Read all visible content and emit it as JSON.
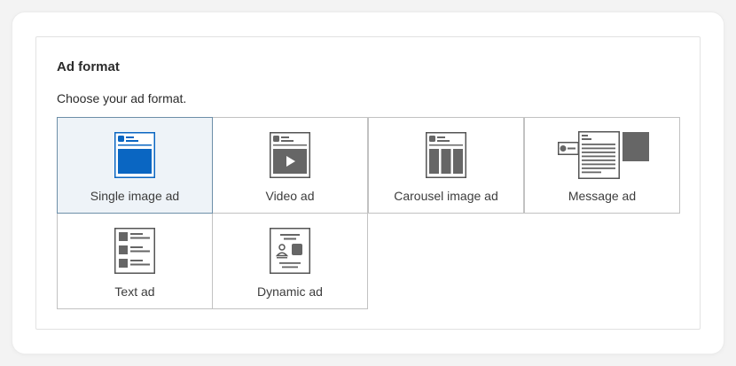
{
  "section": {
    "title": "Ad format",
    "subtitle": "Choose your ad format."
  },
  "formats": [
    {
      "label": "Single image ad",
      "icon": "single-image-ad-icon",
      "selected": true
    },
    {
      "label": "Video ad",
      "icon": "video-ad-icon",
      "selected": false
    },
    {
      "label": "Carousel image ad",
      "icon": "carousel-image-ad-icon",
      "selected": false
    },
    {
      "label": "Message ad",
      "icon": "message-ad-icon",
      "selected": false
    },
    {
      "label": "Text ad",
      "icon": "text-ad-icon",
      "selected": false
    },
    {
      "label": "Dynamic ad",
      "icon": "dynamic-ad-icon",
      "selected": false
    }
  ],
  "colors": {
    "selected_icon_accent": "#0a66c2",
    "icon_gray": "#666666",
    "selected_tile_bg": "#eef3f8"
  }
}
